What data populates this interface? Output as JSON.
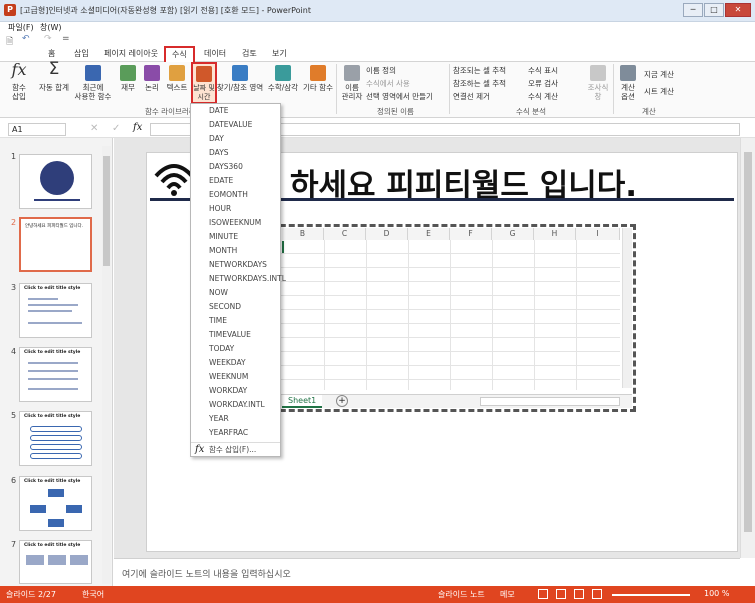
{
  "window": {
    "app_icon_letter": "P",
    "title": "[고급형]인터넷과 소셜미디어(자동완성형 포함) [읽기 전용] [호환 모드] - PowerPoint",
    "minimize": "─",
    "restore": "□",
    "close": "✕"
  },
  "menu": [
    "파일(F)",
    "창(W)"
  ],
  "qat": {
    "save": "🗎",
    "undo": "↶",
    "redo": "↷",
    "customize": "="
  },
  "tabs": [
    "홈",
    "삽입",
    "페이지 레이아웃",
    "수식",
    "데이터",
    "검토",
    "보기"
  ],
  "active_tab": "수식",
  "ribbon": {
    "insert_function": "함수\n삽입",
    "autosum": "자동 합계",
    "recent": "최근에\n사용한 함수",
    "financial": "재무",
    "logical": "논리",
    "text": "텍스트",
    "datetime": "날짜 및\n시간",
    "lookup": "찾기/참조 영역",
    "math": "수학/삼각",
    "more": "기타 함수",
    "group_library": "함수 라이브러리",
    "name_manager": "이름\n관리자",
    "define_name": "이름 정의",
    "use_in_formula": "수식에서 사용",
    "create_from_selection": "선택 영역에서 만들기",
    "group_names": "정의된 이름",
    "trace_precedents": "참조되는 셀 추적",
    "trace_dependents": "참조하는 셀 추적",
    "remove_arrows": "연결선 제거",
    "show_formulas": "수식 표시",
    "error_checking": "오류 검사",
    "evaluate_formula": "수식 계산",
    "group_audit": "수식 분석",
    "watch_window": "조사식\n창",
    "calc_options": "계산\n옵션",
    "calc_now": "지금 계산",
    "calc_sheet": "시트 계산",
    "group_calc": "계산"
  },
  "formula_bar": {
    "name_box": "A1",
    "fx": "fx",
    "cancel": "✕",
    "enter": "✓"
  },
  "slides": [
    {
      "num": "1",
      "title": ""
    },
    {
      "num": "2",
      "title": "안녕하세요 피피티월드 입니다."
    },
    {
      "num": "3",
      "title": "Click to edit title style"
    },
    {
      "num": "4",
      "title": "Click to edit title style"
    },
    {
      "num": "5",
      "title": "Click to edit title style"
    },
    {
      "num": "6",
      "title": "Click to edit title style"
    },
    {
      "num": "7",
      "title": "Click to edit title style"
    }
  ],
  "slide_title": "하세요 피피티월드 입니다.",
  "columns": [
    "B",
    "C",
    "D",
    "E",
    "F",
    "G",
    "H",
    "I"
  ],
  "sheet_tab": "Sheet1",
  "add_sheet": "+",
  "dropdown_items": [
    "DATE",
    "DATEVALUE",
    "DAY",
    "DAYS",
    "DAYS360",
    "EDATE",
    "EOMONTH",
    "HOUR",
    "ISOWEEKNUM",
    "MINUTE",
    "MONTH",
    "NETWORKDAYS",
    "NETWORKDAYS.INTL",
    "NOW",
    "SECOND",
    "TIME",
    "TIMEVALUE",
    "TODAY",
    "WEEKDAY",
    "WEEKNUM",
    "WORKDAY",
    "WORKDAY.INTL",
    "YEAR",
    "YEARFRAC"
  ],
  "dropdown_footer": "함수 삽입(F)...",
  "notes_placeholder": "여기에 슬라이드 노트의 내용을 입력하십시오",
  "status": {
    "slide": "슬라이드 2/27",
    "language": "한국어",
    "notes": "슬라이드 노트",
    "comments": "메모",
    "zoom": "100 %"
  },
  "colors": {
    "status_bar": "#e04520",
    "active_tab_border": "#d72b2b",
    "title_rule": "#1f2a4a"
  }
}
